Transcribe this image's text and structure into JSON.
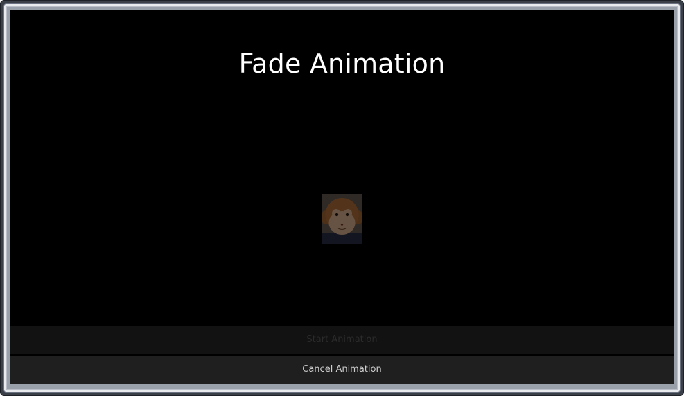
{
  "window": {
    "frame_color": "#3a3f48"
  },
  "screen": {
    "background": "#000000",
    "title": "Fade Animation"
  },
  "image": {
    "icon": "monkey-face-icon",
    "opacity": 0.45
  },
  "buttons": {
    "start_label": "Start Animation",
    "start_enabled": false,
    "cancel_label": "Cancel Animation",
    "cancel_enabled": true
  }
}
